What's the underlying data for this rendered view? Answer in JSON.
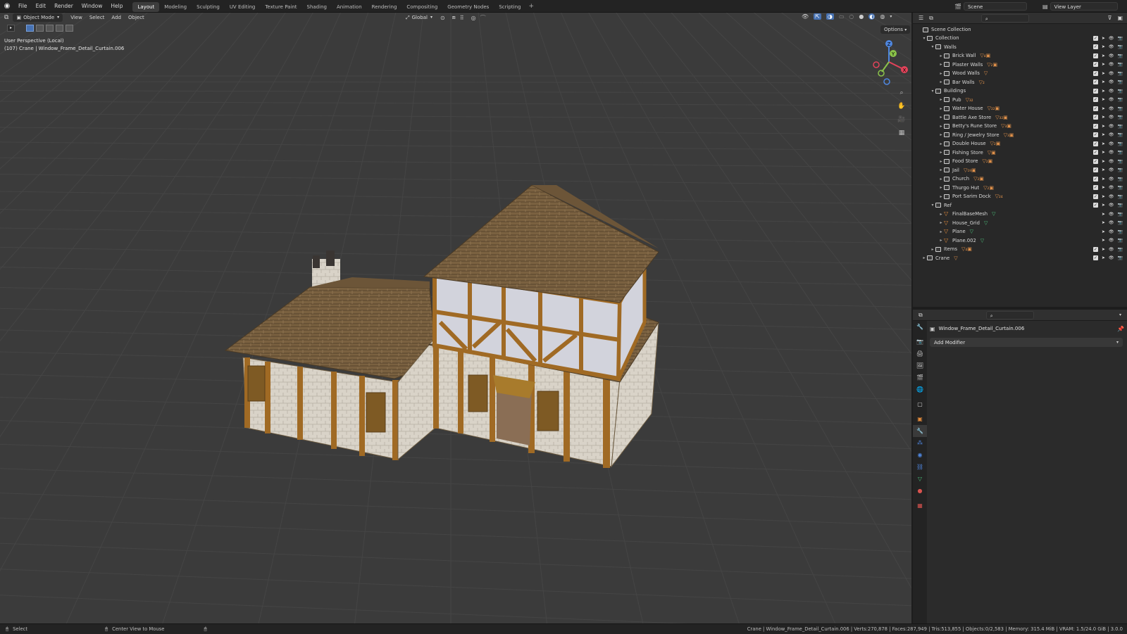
{
  "menu": {
    "items": [
      "File",
      "Edit",
      "Render",
      "Window",
      "Help"
    ],
    "workspaces": [
      "Layout",
      "Modeling",
      "Sculpting",
      "UV Editing",
      "Texture Paint",
      "Shading",
      "Animation",
      "Rendering",
      "Compositing",
      "Geometry Nodes",
      "Scripting"
    ],
    "active_workspace": "Layout",
    "add_tab": "+",
    "scene": "Scene",
    "view_layer": "View Layer"
  },
  "viewport_header": {
    "mode": "Object Mode",
    "menus": [
      "View",
      "Select",
      "Add",
      "Object"
    ],
    "transform_orientation": "Global",
    "options": "Options"
  },
  "viewport_overlay": {
    "line1": "User Perspective (Local)",
    "line2": "(107) Crane | Window_Frame_Detail_Curtain.006"
  },
  "gizmo": {
    "x": "X",
    "y": "Y",
    "z": "Z"
  },
  "outliner": {
    "scene_collection": "Scene Collection",
    "rows": [
      {
        "label": "Collection",
        "depth": 0,
        "kind": "col",
        "open": true,
        "extra": ""
      },
      {
        "label": "Walls",
        "depth": 1,
        "kind": "col",
        "open": true,
        "extra": ""
      },
      {
        "label": "Brick Wall",
        "depth": 2,
        "kind": "col",
        "open": false,
        "extra": "▽₄▣"
      },
      {
        "label": "Plaster Walls",
        "depth": 2,
        "kind": "col",
        "open": false,
        "extra": "▽₂▣"
      },
      {
        "label": "Wood Walls",
        "depth": 2,
        "kind": "col",
        "open": false,
        "extra": "▽"
      },
      {
        "label": "Bar Walls",
        "depth": 2,
        "kind": "col",
        "open": false,
        "extra": "▽₂"
      },
      {
        "label": "Buildings",
        "depth": 1,
        "kind": "col",
        "open": true,
        "extra": ""
      },
      {
        "label": "Pub",
        "depth": 2,
        "kind": "col",
        "open": false,
        "extra": "▽₃₂"
      },
      {
        "label": "Water House",
        "depth": 2,
        "kind": "col",
        "open": false,
        "extra": "▽₂₂▣"
      },
      {
        "label": "Battle Axe Store",
        "depth": 2,
        "kind": "col",
        "open": false,
        "extra": "▽₃₂▣"
      },
      {
        "label": "Betty's Rune Store",
        "depth": 2,
        "kind": "col",
        "open": false,
        "extra": "▽₃▣"
      },
      {
        "label": "Ring / Jewelry Store",
        "depth": 2,
        "kind": "col",
        "open": false,
        "extra": "▽₃▣"
      },
      {
        "label": "Double House",
        "depth": 2,
        "kind": "col",
        "open": false,
        "extra": "▽₂▣"
      },
      {
        "label": "Fishing Store",
        "depth": 2,
        "kind": "col",
        "open": false,
        "extra": "▽▣"
      },
      {
        "label": "Food Store",
        "depth": 2,
        "kind": "col",
        "open": false,
        "extra": "▽₂▣"
      },
      {
        "label": "Jail",
        "depth": 2,
        "kind": "col",
        "open": false,
        "extra": "▽₁₉▣"
      },
      {
        "label": "Church",
        "depth": 2,
        "kind": "col",
        "open": false,
        "extra": "▽₂▣"
      },
      {
        "label": "Thurgo Hut",
        "depth": 2,
        "kind": "col",
        "open": false,
        "extra": "▽₂▣"
      },
      {
        "label": "Port Sarim Dock",
        "depth": 2,
        "kind": "col",
        "open": false,
        "extra": "▽₂₄"
      },
      {
        "label": "Ref",
        "depth": 1,
        "kind": "col",
        "open": true,
        "extra": ""
      },
      {
        "label": "FinalBaseMesh",
        "depth": 2,
        "kind": "obj",
        "open": false,
        "extra": "▽"
      },
      {
        "label": "House_Grid",
        "depth": 2,
        "kind": "obj",
        "open": false,
        "extra": "▽"
      },
      {
        "label": "Plane",
        "depth": 2,
        "kind": "obj",
        "open": false,
        "extra": "▽"
      },
      {
        "label": "Plane.002",
        "depth": 2,
        "kind": "obj",
        "open": false,
        "extra": "▽"
      },
      {
        "label": "Items",
        "depth": 1,
        "kind": "col",
        "open": false,
        "extra": "▽₄▣"
      },
      {
        "label": "Crane",
        "depth": 0,
        "kind": "col",
        "open": false,
        "extra": "▽"
      }
    ]
  },
  "properties": {
    "object_name": "Window_Frame_Detail_Curtain.006",
    "add_modifier": "Add Modifier"
  },
  "statusbar": {
    "select": "Select",
    "center_view": "Center View to Mouse",
    "stats": "Crane | Window_Frame_Detail_Curtain.006 | Verts:270,878 | Faces:287,949 | Tris:513,855 | Objects:0/2,583 | Memory: 315.4 MiB | VRAM: 1.5/24.0 GiB | 3.0.0"
  },
  "colors": {
    "accent": "#4772b3",
    "object_orange": "#e08a3b",
    "mesh_green": "#4bc07b",
    "x_axis": "#e2435a",
    "y_axis": "#8bc34a",
    "z_axis": "#4f87e0"
  }
}
